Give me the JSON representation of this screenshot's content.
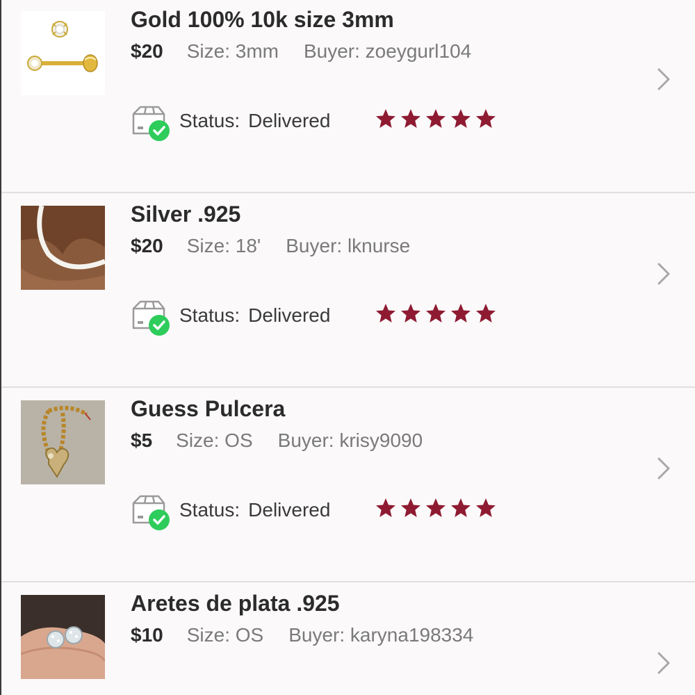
{
  "colors": {
    "star": "#8e1b32",
    "check_green": "#2ecc5b",
    "divider": "#e2dfe0",
    "secondary_text": "#7a7a7a",
    "background": "#fbf9fa"
  },
  "orders": [
    {
      "title": "Gold 100% 10k size 3mm",
      "price": "$20",
      "size": "Size: 3mm",
      "buyer": "Buyer: zoeygurl104",
      "status_label": "Status:",
      "status_value": "Delivered",
      "rating": 5,
      "thumbnail": "gold-earring-photo"
    },
    {
      "title": "Silver .925",
      "price": "$20",
      "size": "Size: 18'",
      "buyer": "Buyer: lknurse",
      "status_label": "Status:",
      "status_value": "Delivered",
      "rating": 5,
      "thumbnail": "silver-necklace-photo"
    },
    {
      "title": "Guess Pulcera",
      "price": "$5",
      "size": "Size: OS",
      "buyer": "Buyer: krisy9090",
      "status_label": "Status:",
      "status_value": "Delivered",
      "rating": 5,
      "thumbnail": "gold-bracelet-photo"
    },
    {
      "title": "Aretes de plata .925",
      "price": "$10",
      "size": "Size: OS",
      "buyer": "Buyer: karyna198334",
      "thumbnail": "silver-earrings-photo"
    }
  ]
}
